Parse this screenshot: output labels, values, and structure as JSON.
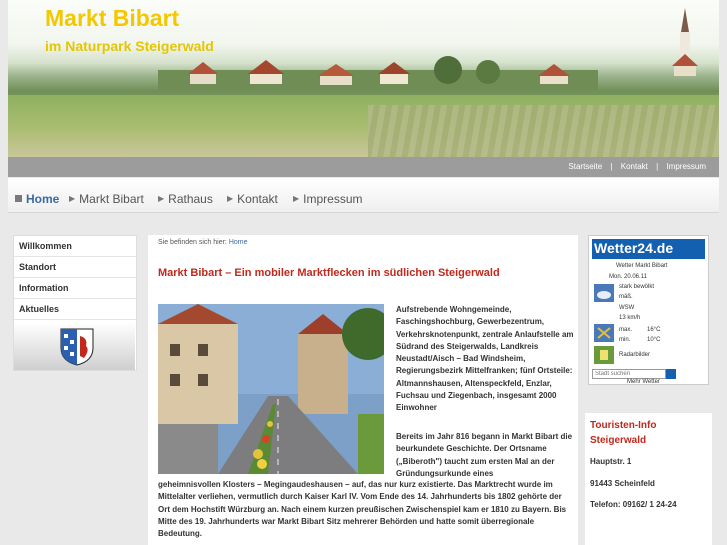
{
  "header": {
    "title": "Markt Bibart",
    "subtitle": "im Naturpark Steigerwald"
  },
  "toplinks": [
    "Startseite",
    "|",
    "Kontakt",
    "|",
    "Impressum"
  ],
  "nav": {
    "items": [
      {
        "label": "Home",
        "active": true
      },
      {
        "label": "Markt Bibart",
        "active": false
      },
      {
        "label": "Rathaus",
        "active": false
      },
      {
        "label": "Kontakt",
        "active": false
      },
      {
        "label": "Impressum",
        "active": false
      }
    ]
  },
  "sidebar": {
    "items": [
      {
        "label": "Willkommen"
      },
      {
        "label": "Standort"
      },
      {
        "label": "Information"
      },
      {
        "label": "Aktuelles"
      }
    ]
  },
  "main": {
    "breadcrumb_prefix": "Sie befinden sich hier:",
    "breadcrumb_link": "Home",
    "headline": "Markt Bibart – Ein mobiler Marktflecken im südlichen Steigerwald",
    "para1": "Aufstrebende Wohngemeinde, Faschingshochburg, Gewerbezentrum, Verkehrsknotenpunkt, zentrale Anlaufstelle am Südrand des Steigerwalds, Landkreis Neustadt/Aisch – Bad Windsheim, Regierungsbezirk Mittelfranken; fünf Ortsteile: Altmannshausen, Altenspeckfeld, Enzlar, Fuchsau und Ziegenbach, insgesamt 2000 Einwohner",
    "para2": "Bereits im Jahr 816 begann in Markt Bibart die beurkundete Geschichte. Der Ortsname („Biberoth\") taucht zum ersten Mal an der Gründungsurkunde eines",
    "para3": "geheimnisvollen Klosters – Megingaudeshausen – auf, das nur kurz existierte. Das Marktrecht wurde im Mittelalter verliehen, vermutlich durch Kaiser Karl IV. Vom Ende des 14. Jahrhunderts bis 1802 gehörte der Ort dem Hochstift Würzburg an. Nach einem kurzen preußischen Zwischenspiel kam er 1810 zu Bayern. Bis Mitte des 19. Jahrhunderts war Markt Bibart Sitz mehrerer Behörden und hatte somit überregionale Bedeutung."
  },
  "weather": {
    "logo": "Wetter24.de",
    "title": "Wetter Markt Bibart",
    "date": "Mon. 20.06.11",
    "cond1": "stark bewölkt",
    "cond2": "mäß.",
    "wind_dir": "WSW",
    "wind_speed": "13 km/h",
    "max_label": "max.",
    "max_val": "16°C",
    "min_label": "min.",
    "min_val": "10°C",
    "radar": "Radarbilder",
    "search_placeholder": "Stadt suchen",
    "more": "Mehr Wetter"
  },
  "touristinfo": {
    "title": "Touristen-Info Steigerwald",
    "street": "Hauptstr. 1",
    "city": "91443 Scheinfeld",
    "phone": "Telefon: 09162/ 1 24-24"
  },
  "colors": {
    "accent_red": "#c0291c",
    "link_blue": "#3a6aa0",
    "title_yellow": "#f3c800",
    "wetter_blue": "#1460b0"
  }
}
